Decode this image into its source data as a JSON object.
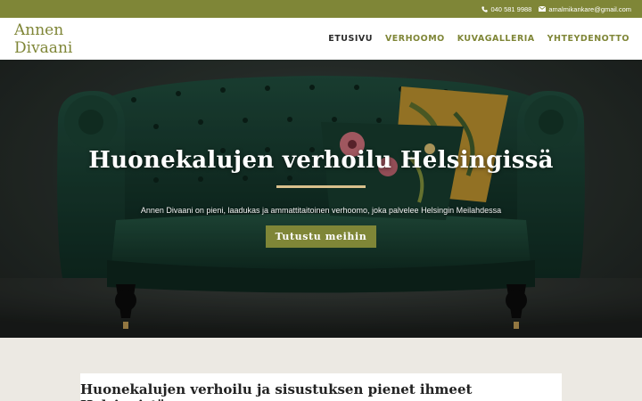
{
  "topbar": {
    "phone": "040 581 9988",
    "email": "amalmikankare@gmail.com",
    "phone_icon": "phone-icon",
    "email_icon": "mail-icon",
    "bg_color": "#7f8637"
  },
  "header": {
    "logo_line1": "Annen",
    "logo_line2": "Divaani",
    "nav": [
      "ETUSIVU",
      "VERHOOMO",
      "KUVAGALLERIA",
      "YHTEYDENOTTO"
    ],
    "active_nav": "ETUSIVU",
    "accent_color": "#7f8637"
  },
  "hero": {
    "title": "Huonekalujen verhoilu Helsingissä",
    "subtitle": "Annen Divaani on pieni, laadukas ja ammattitaitoinen verhoomo, joka palvelee Helsingin Meilahdessa",
    "button": "Tutustu meihin",
    "rule_color": "#d9c08c"
  },
  "section": {
    "title": "Huonekalujen verhoilu ja sisustuksen pienet ihmeet Helsingistä"
  }
}
